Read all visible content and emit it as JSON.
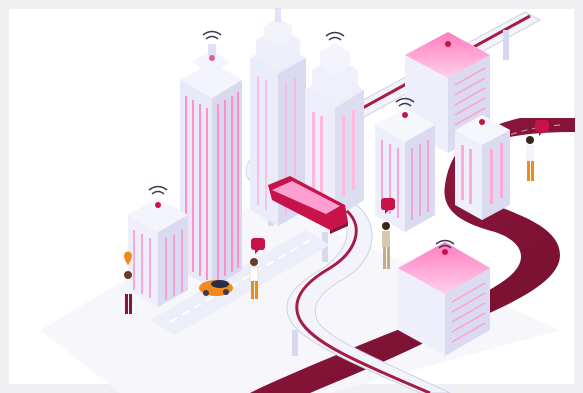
{
  "illustration": {
    "subject": "isometric-smart-city",
    "colors": {
      "background": "#ffffff",
      "frame": "#f0f0f3",
      "tower_light": "#eef0fb",
      "tower_mid": "#e3e4f6",
      "tower_dark": "#d5d6ee",
      "accent_pink": "#ff8fc9",
      "accent_magenta": "#e05aa4",
      "road_dark": "#8a1538",
      "road_deep": "#6e0e2b",
      "road_light": "#f3f4fb",
      "car_orange": "#f08a1a",
      "train_red": "#c8124a"
    },
    "icons": [
      "wifi-signal-icon",
      "location-pin-icon",
      "chat-bubble-icon"
    ]
  }
}
